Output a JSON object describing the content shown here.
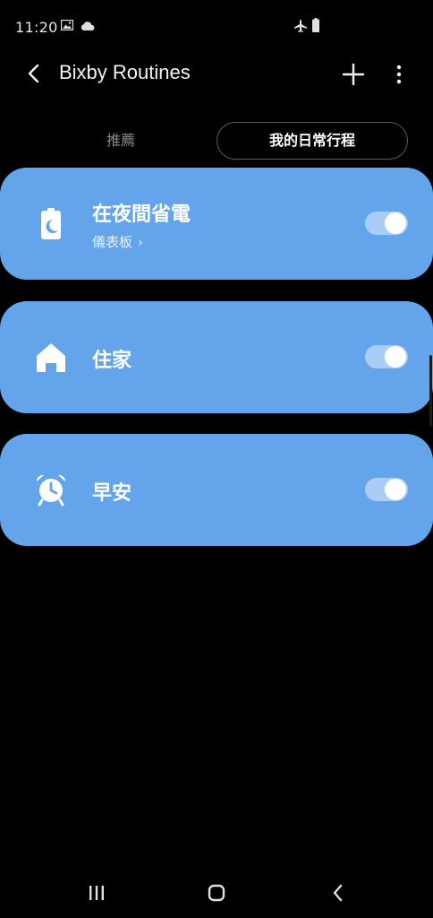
{
  "status_bar": {
    "time": "11:20",
    "icons": [
      "gallery-icon",
      "cloud-icon",
      "airplane-icon",
      "battery-icon"
    ]
  },
  "app_bar": {
    "title": "Bixby Routines",
    "back_icon": "chevron-left-icon",
    "add_icon": "plus-icon",
    "more_icon": "more-vertical-icon"
  },
  "tabs": [
    {
      "label": "推薦",
      "selected": false
    },
    {
      "label": "我的日常行程",
      "selected": true
    }
  ],
  "routines": [
    {
      "title": "在夜間省電",
      "subtitle": "儀表板",
      "icon": "battery-moon-icon",
      "enabled": true
    },
    {
      "title": "住家",
      "icon": "home-icon",
      "enabled": true
    },
    {
      "title": "早安",
      "icon": "alarm-clock-icon",
      "enabled": true
    }
  ],
  "colors": {
    "background": "#000000",
    "card": "#63a4eb",
    "toggle_track": "#a9cdf5",
    "toggle_knob": "#ffffff"
  },
  "nav_bar": {
    "icons": [
      "recents-icon",
      "home-button-icon",
      "back-nav-icon"
    ]
  }
}
